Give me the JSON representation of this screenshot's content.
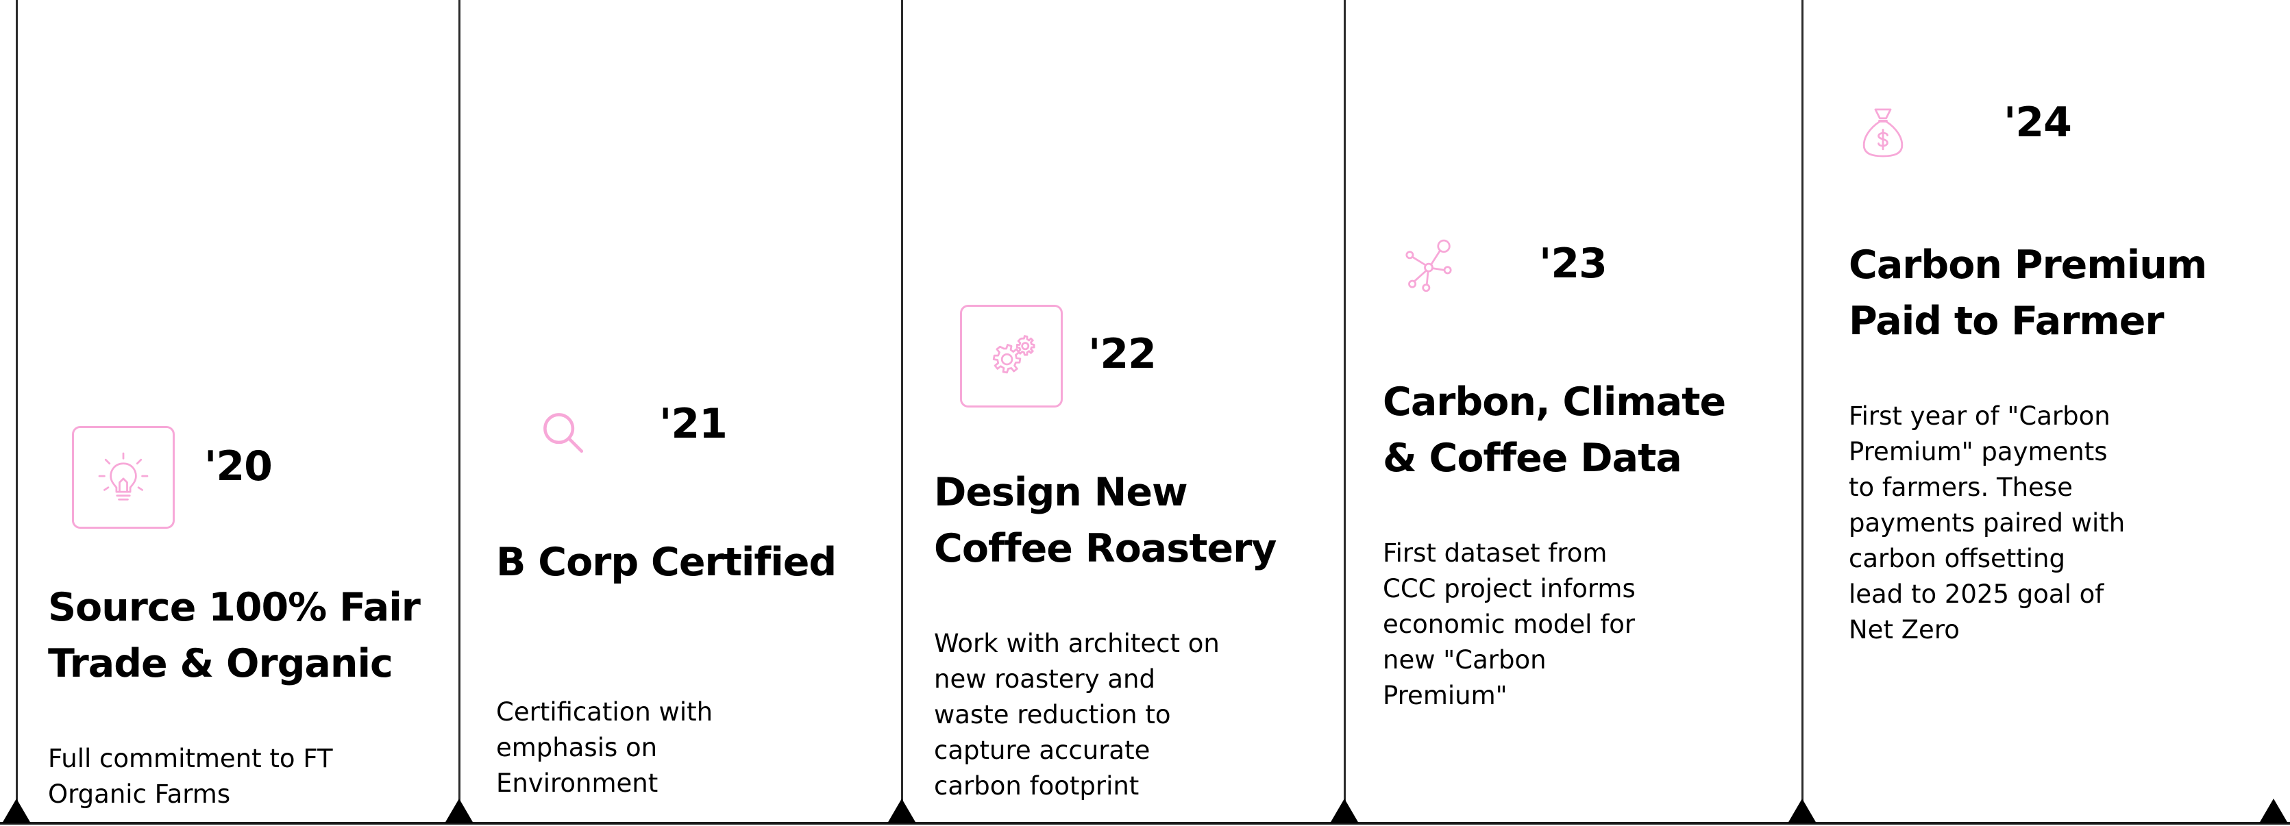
{
  "colors": {
    "accent": "#f7a8d8",
    "line": "#1a1a1a",
    "text": "#000000"
  },
  "milestones": [
    {
      "year": "'20",
      "icon": "lightbulb-icon",
      "title": "Source 100% Fair\nTrade & Organic",
      "description": "Full commitment to FT\nOrganic Farms"
    },
    {
      "year": "'21",
      "icon": "search-icon",
      "title": "B Corp Certified",
      "description": "Certification with\nemphasis on\nEnvironment"
    },
    {
      "year": "'22",
      "icon": "gears-icon",
      "title": "Design New\nCoffee Roastery",
      "description": "Work with architect on\nnew roastery and\nwaste reduction to\ncapture accurate\ncarbon footprint"
    },
    {
      "year": "'23",
      "icon": "network-icon",
      "title": "Carbon, Climate\n& Coffee Data",
      "description": "First dataset from\nCCC project informs\neconomic model for\nnew \"Carbon\nPremium\""
    },
    {
      "year": "'24",
      "icon": "money-bag-icon",
      "title": "Carbon Premium\nPaid to Farmer",
      "description": "First year of \"Carbon\nPremium\" payments\nto farmers. These\npayments paired with\ncarbon offsetting\n lead to 2025 goal of\nNet Zero"
    }
  ]
}
